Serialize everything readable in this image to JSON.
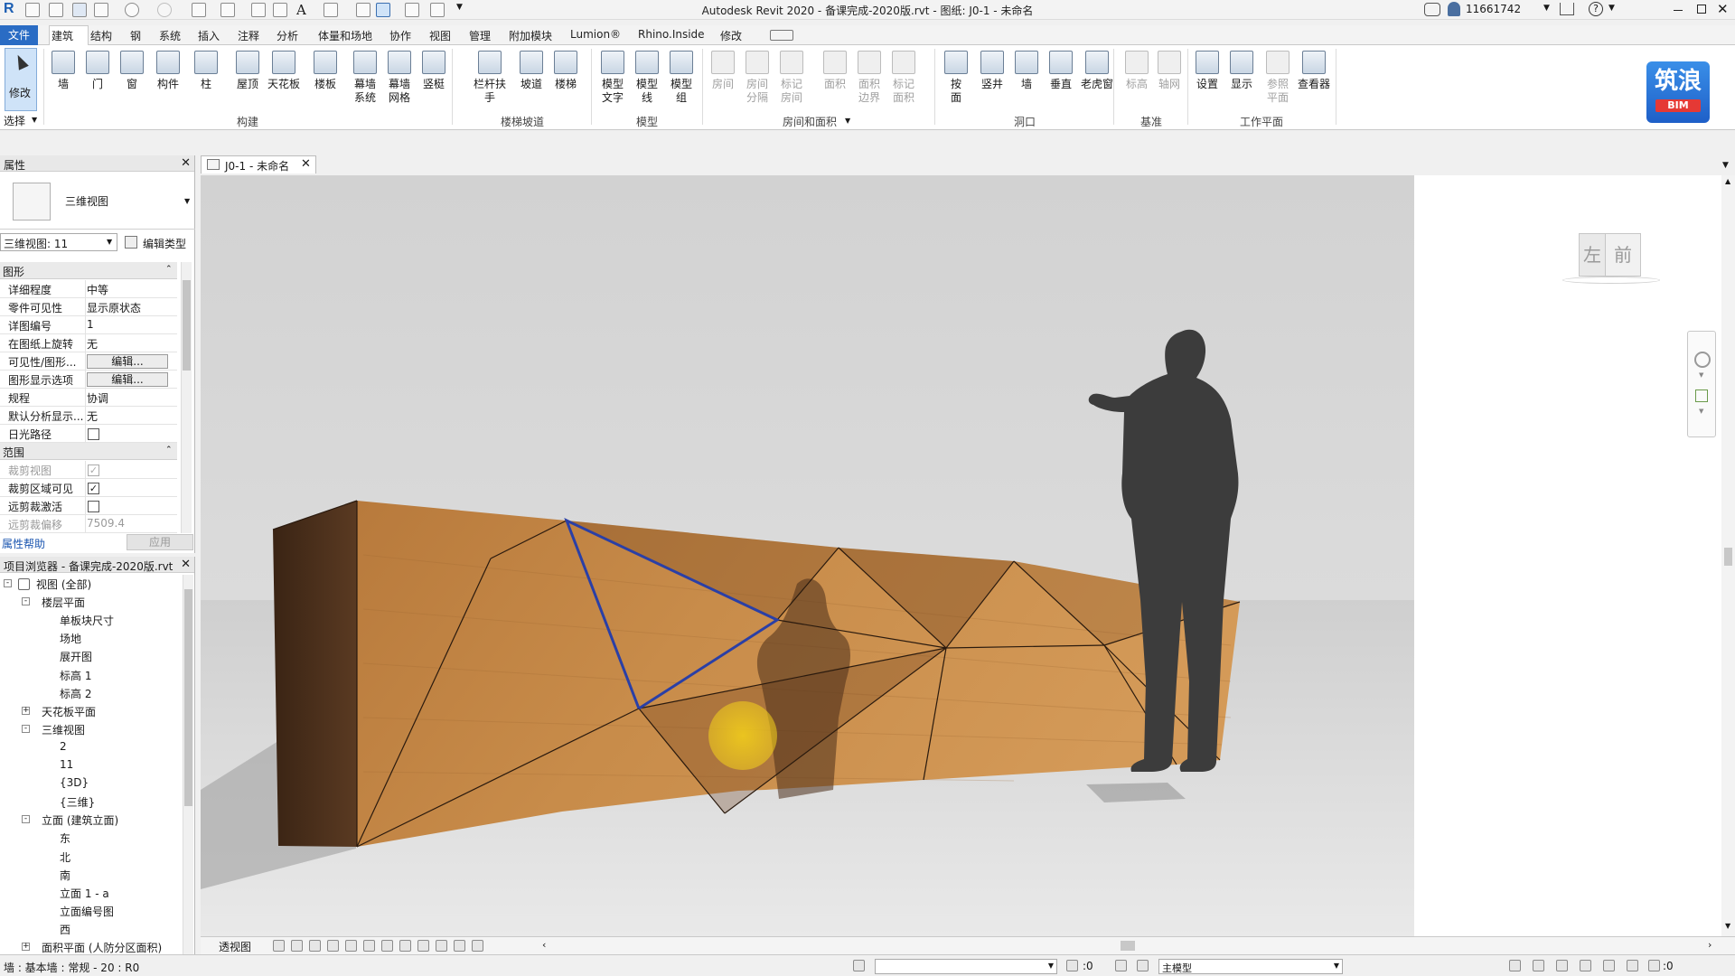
{
  "app": {
    "title": "Autodesk Revit 2020 - 备课完成-2020版.rvt - 图纸: J0-1 - 未命名",
    "user": "11661742"
  },
  "ribbon_tabs": [
    "文件",
    "建筑",
    "结构",
    "钢",
    "系统",
    "插入",
    "注释",
    "分析",
    "体量和场地",
    "协作",
    "视图",
    "管理",
    "附加模块",
    "Lumion®",
    "Rhino.Inside",
    "修改"
  ],
  "ribbon": {
    "select_label": "修改",
    "select_panel": "选择",
    "buttons": [
      {
        "label": "墙",
        "icon": "wall-icon"
      },
      {
        "label": "门",
        "icon": "door-icon"
      },
      {
        "label": "窗",
        "icon": "window-icon"
      },
      {
        "label": "构件",
        "icon": "component-icon"
      },
      {
        "label": "柱",
        "icon": "column-icon"
      },
      {
        "label": "屋顶",
        "icon": "roof-icon"
      },
      {
        "label": "天花板",
        "icon": "ceiling-icon"
      },
      {
        "label": "楼板",
        "icon": "floor-icon"
      },
      {
        "label": "幕墙\n系统",
        "icon": "curtain-system-icon"
      },
      {
        "label": "幕墙\n网格",
        "icon": "curtain-grid-icon"
      },
      {
        "label": "竖梃",
        "icon": "mullion-icon"
      },
      {
        "label": "栏杆扶手",
        "icon": "railing-icon"
      },
      {
        "label": "坡道",
        "icon": "ramp-icon"
      },
      {
        "label": "楼梯",
        "icon": "stair-icon"
      },
      {
        "label": "模型\n文字",
        "icon": "model-text-icon"
      },
      {
        "label": "模型\n线",
        "icon": "model-line-icon"
      },
      {
        "label": "模型\n组",
        "icon": "model-group-icon"
      },
      {
        "label": "房间",
        "icon": "room-icon",
        "dim": true
      },
      {
        "label": "房间\n分隔",
        "icon": "room-separator-icon",
        "dim": true
      },
      {
        "label": "标记\n房间",
        "icon": "tag-room-icon",
        "dim": true
      },
      {
        "label": "面积",
        "icon": "area-icon",
        "dim": true
      },
      {
        "label": "面积\n边界",
        "icon": "area-boundary-icon",
        "dim": true
      },
      {
        "label": "标记\n面积",
        "icon": "tag-area-icon",
        "dim": true
      },
      {
        "label": "按\n面",
        "icon": "by-face-icon"
      },
      {
        "label": "竖井",
        "icon": "shaft-icon"
      },
      {
        "label": "墙",
        "icon": "wall-opening-icon"
      },
      {
        "label": "垂直",
        "icon": "vertical-icon"
      },
      {
        "label": "老虎窗",
        "icon": "dormer-icon"
      },
      {
        "label": "标高",
        "icon": "level-icon",
        "dim": true
      },
      {
        "label": "轴网",
        "icon": "grid-icon",
        "dim": true
      },
      {
        "label": "设置",
        "icon": "set-icon"
      },
      {
        "label": "显示",
        "icon": "show-icon"
      },
      {
        "label": "参照\n平面",
        "icon": "ref-plane-icon",
        "dim": true
      },
      {
        "label": "查看器",
        "icon": "viewer-icon"
      }
    ],
    "panels": [
      "构建",
      "楼梯坡道",
      "模型",
      "房间和面积",
      "洞口",
      "基准",
      "工作平面"
    ],
    "logo_text": "筑浪",
    "logo_sub": "BIM"
  },
  "properties": {
    "title": "属性",
    "type_name": "三维视图",
    "instance_selector": "三维视图: 11",
    "edit_type": "编辑类型",
    "group_graphics": "图形",
    "group_extents": "范围",
    "rows": [
      {
        "k": "详细程度",
        "v": "中等"
      },
      {
        "k": "零件可见性",
        "v": "显示原状态"
      },
      {
        "k": "详图编号",
        "v": "1"
      },
      {
        "k": "在图纸上旋转",
        "v": "无"
      },
      {
        "k": "可见性/图形...",
        "v": "编辑..."
      },
      {
        "k": "图形显示选项",
        "v": "编辑..."
      },
      {
        "k": "规程",
        "v": "协调"
      },
      {
        "k": "默认分析显示...",
        "v": "无"
      },
      {
        "k": "日光路径",
        "v": ""
      }
    ],
    "extent_rows": [
      {
        "k": "裁剪视图",
        "v": ""
      },
      {
        "k": "裁剪区域可见",
        "v": ""
      },
      {
        "k": "远剪裁激活",
        "v": ""
      },
      {
        "k": "远剪裁偏移",
        "v": "7509.4"
      }
    ],
    "help": "属性帮助",
    "apply": "应用"
  },
  "browser": {
    "title": "项目浏览器 - 备课完成-2020版.rvt",
    "nodes": [
      {
        "text": "视图 (全部)",
        "level": 0,
        "exp": "-"
      },
      {
        "text": "楼层平面",
        "level": 1,
        "exp": "-"
      },
      {
        "text": "单板块尺寸",
        "level": 2
      },
      {
        "text": "场地",
        "level": 2
      },
      {
        "text": "展开图",
        "level": 2
      },
      {
        "text": "标高 1",
        "level": 2
      },
      {
        "text": "标高 2",
        "level": 2
      },
      {
        "text": "天花板平面",
        "level": 1,
        "exp": "+"
      },
      {
        "text": "三维视图",
        "level": 1,
        "exp": "-"
      },
      {
        "text": "2",
        "level": 2
      },
      {
        "text": "11",
        "level": 2
      },
      {
        "text": "{3D}",
        "level": 2
      },
      {
        "text": "{三维}",
        "level": 2
      },
      {
        "text": "立面 (建筑立面)",
        "level": 1,
        "exp": "-"
      },
      {
        "text": "东",
        "level": 2
      },
      {
        "text": "北",
        "level": 2
      },
      {
        "text": "南",
        "level": 2
      },
      {
        "text": "立面 1 - a",
        "level": 2
      },
      {
        "text": "立面编号图",
        "level": 2
      },
      {
        "text": "西",
        "level": 2
      },
      {
        "text": "面积平面 (人防分区面积)",
        "level": 1,
        "exp": "+"
      }
    ]
  },
  "view": {
    "tab_label": "J0-1 - 未命名",
    "viewcube_left": "左",
    "viewcube_front": "前",
    "view_mode": "透视图"
  },
  "status": {
    "text": "墙 : 基本墙 : 常规 - 20 : R0",
    "zero1": ":0",
    "model": "主模型",
    "filter": ":0"
  }
}
